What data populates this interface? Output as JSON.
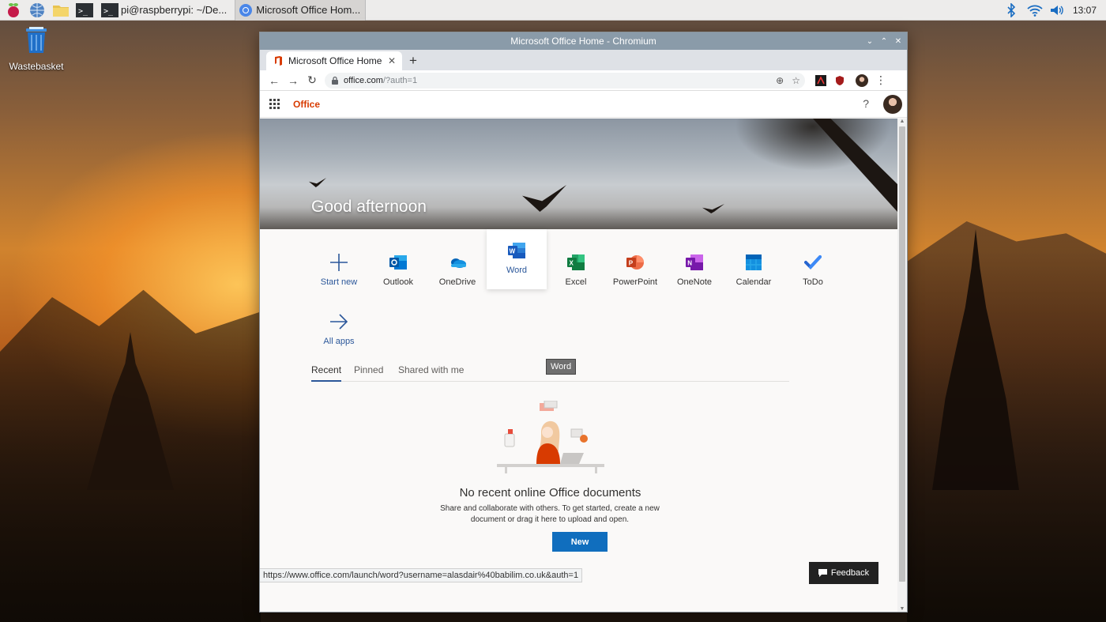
{
  "taskbar": {
    "tasks": [
      {
        "label": "pi@raspberrypi: ~/De..."
      },
      {
        "label": "Microsoft Office Hom..."
      }
    ],
    "clock": "13:07"
  },
  "desktop": {
    "icon_label": "Wastebasket"
  },
  "window": {
    "title": "Microsoft Office Home - Chromium"
  },
  "browser": {
    "tab_title": "Microsoft Office Home",
    "url_host": "office.com",
    "url_rest": "/?auth=1"
  },
  "office": {
    "brand": "Office",
    "help": "?",
    "greeting": "Good afternoon",
    "apps": [
      {
        "label": "Start new"
      },
      {
        "label": "Outlook"
      },
      {
        "label": "OneDrive"
      },
      {
        "label": "Word"
      },
      {
        "label": "Excel"
      },
      {
        "label": "PowerPoint"
      },
      {
        "label": "OneNote"
      },
      {
        "label": "Calendar"
      },
      {
        "label": "ToDo"
      },
      {
        "label": "All apps"
      }
    ],
    "tooltip": "Word",
    "doc_tabs": [
      "Recent",
      "Pinned",
      "Shared with me"
    ],
    "empty_title": "No recent online Office documents",
    "empty_subtitle": "Share and collaborate with others. To get started, create a new document or drag it here to upload and open.",
    "new_button": "New",
    "feedback": "Feedback",
    "status_url": "https://www.office.com/launch/word?username=alasdair%40babilim.co.uk&auth=1"
  },
  "colors": {
    "office_orange": "#d83b01",
    "word_blue": "#2b579a",
    "button_blue": "#106ebe"
  }
}
